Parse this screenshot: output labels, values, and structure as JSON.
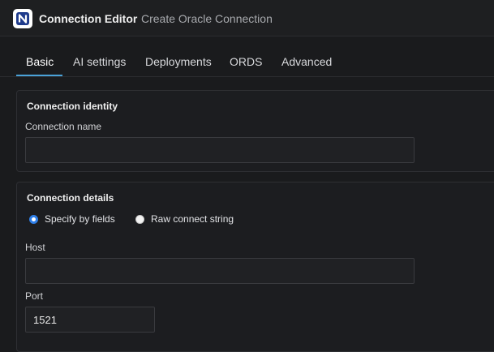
{
  "window": {
    "title": "Connection Editor",
    "subtitle": "Create Oracle Connection",
    "logo_icon": "n-logo-icon"
  },
  "tabs": [
    {
      "label": "Basic",
      "active": true
    },
    {
      "label": "AI settings",
      "active": false
    },
    {
      "label": "Deployments",
      "active": false
    },
    {
      "label": "ORDS",
      "active": false
    },
    {
      "label": "Advanced",
      "active": false
    }
  ],
  "identity": {
    "section_title": "Connection identity",
    "name_label": "Connection name",
    "name_value": "",
    "name_placeholder": ""
  },
  "details": {
    "section_title": "Connection details",
    "options": [
      {
        "label": "Specify by fields",
        "checked": true
      },
      {
        "label": "Raw connect string",
        "checked": false
      }
    ],
    "host_label": "Host",
    "host_value": "",
    "port_label": "Port",
    "port_value": "1521"
  },
  "colors": {
    "accent": "#4aa2d8",
    "radio_selected": "#2f7fe8",
    "background": "#1a1b1d"
  }
}
